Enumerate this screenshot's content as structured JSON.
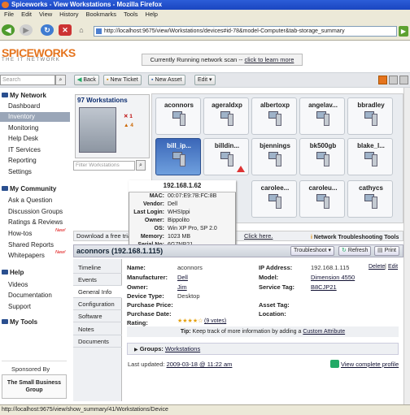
{
  "window": {
    "title": "Spiceworks - View Workstations - Mozilla Firefox"
  },
  "menu": [
    "File",
    "Edit",
    "View",
    "History",
    "Bookmarks",
    "Tools",
    "Help"
  ],
  "browser": {
    "url": "http://localhost:9675/view/Workstations/devices#id-78&model-Computer&tab-storage_summary",
    "status_url": "http://localhost:9675/view/show_summary/41/Workstations/Device"
  },
  "logo": {
    "name": "SPICEWORKS",
    "tagline": "THE IT NETWORK"
  },
  "scan": {
    "text": "Currently Running network scan --",
    "link": "click to learn more"
  },
  "toolbar": {
    "search_placeholder": "Search",
    "back": "Back",
    "new_ticket": "New Ticket",
    "new_asset": "New Asset",
    "edit": "Edit"
  },
  "sidebar": {
    "my_network": "My Network",
    "items_network": [
      "Dashboard",
      "Inventory",
      "Monitoring",
      "Help Desk",
      "IT Services",
      "Reporting",
      "Settings"
    ],
    "my_community": "My Community",
    "items_community": [
      "Ask a Question",
      "Discussion Groups",
      "Ratings & Reviews",
      "How-tos",
      "Shared Reports",
      "Whitepapers"
    ],
    "new_label": "New!",
    "help": "Help",
    "items_help": [
      "Videos",
      "Documentation",
      "Support"
    ],
    "my_tools": "My Tools",
    "sponsored": "Sponsored By",
    "sponsor_name": "The Small Business Group"
  },
  "workstations": {
    "title": "97 Workstations",
    "counts": [
      "1",
      "4"
    ],
    "filter_placeholder": "Filter Workstations"
  },
  "devices": [
    "aconnors",
    "ageraldxp",
    "albertoxp",
    "angelav...",
    "bbradley",
    "bill_ip...",
    "billdin...",
    "bjennings",
    "bk500gb",
    "blake_l...",
    "carolee...",
    "caroleu...",
    "cathycs"
  ],
  "popup": {
    "ip": "192.168.1.62",
    "rows": [
      [
        "MAC:",
        "00:07:E9:7B:FC:8B"
      ],
      [
        "Vendor:",
        "Dell"
      ],
      [
        "Last Login:",
        "WHSIppi"
      ],
      [
        "Owner:",
        "Bippolito"
      ],
      [
        "OS:",
        "Win XP Pro, SP 2.0"
      ],
      [
        "Memory:",
        "1023 MB"
      ],
      [
        "Serial No:",
        "6G7NR21"
      ]
    ]
  },
  "download": {
    "text": "Download a free trial",
    "link": "Click here."
  },
  "troubleshoot_label": "Network Troubleshooting Tools",
  "detail": {
    "title": "aconnors (192.168.1.115)",
    "troubleshoot": "Troubleshoot",
    "refresh": "Refresh",
    "print": "Print",
    "tabs": [
      "Timeline",
      "Events",
      "General Info",
      "Configuration",
      "Software",
      "Notes",
      "Documents"
    ],
    "fields_left": [
      [
        "Name:",
        "aconnors"
      ],
      [
        "Manufacturer:",
        "Dell"
      ],
      [
        "Owner:",
        "Jim"
      ],
      [
        "Device Type:",
        "Desktop"
      ],
      [
        "Purchase Price:",
        ""
      ],
      [
        "Purchase Date:",
        ""
      ],
      [
        "Rating:",
        ""
      ]
    ],
    "fields_right": [
      [
        "IP Address:",
        "192.168.1.115"
      ],
      [
        "Model:",
        "Dimension 4550"
      ],
      [
        "Service Tag:",
        "B8CJP21"
      ],
      [
        "",
        ""
      ],
      [
        "Asset Tag:",
        ""
      ],
      [
        "Location:",
        ""
      ]
    ],
    "delete": "Delete",
    "edit": "Edit",
    "rating_votes": "(9 votes)",
    "stars": "★★★★☆",
    "tip_prefix": "Tip:",
    "tip": "Keep track of more information by adding a",
    "tip_link": "Custom Attribute",
    "groups_label": "Groups:",
    "groups_value": "Workstations",
    "last_updated_label": "Last updated:",
    "last_updated": "2009-03-18 @ 11:22 am",
    "complete_profile": "View complete profile"
  }
}
